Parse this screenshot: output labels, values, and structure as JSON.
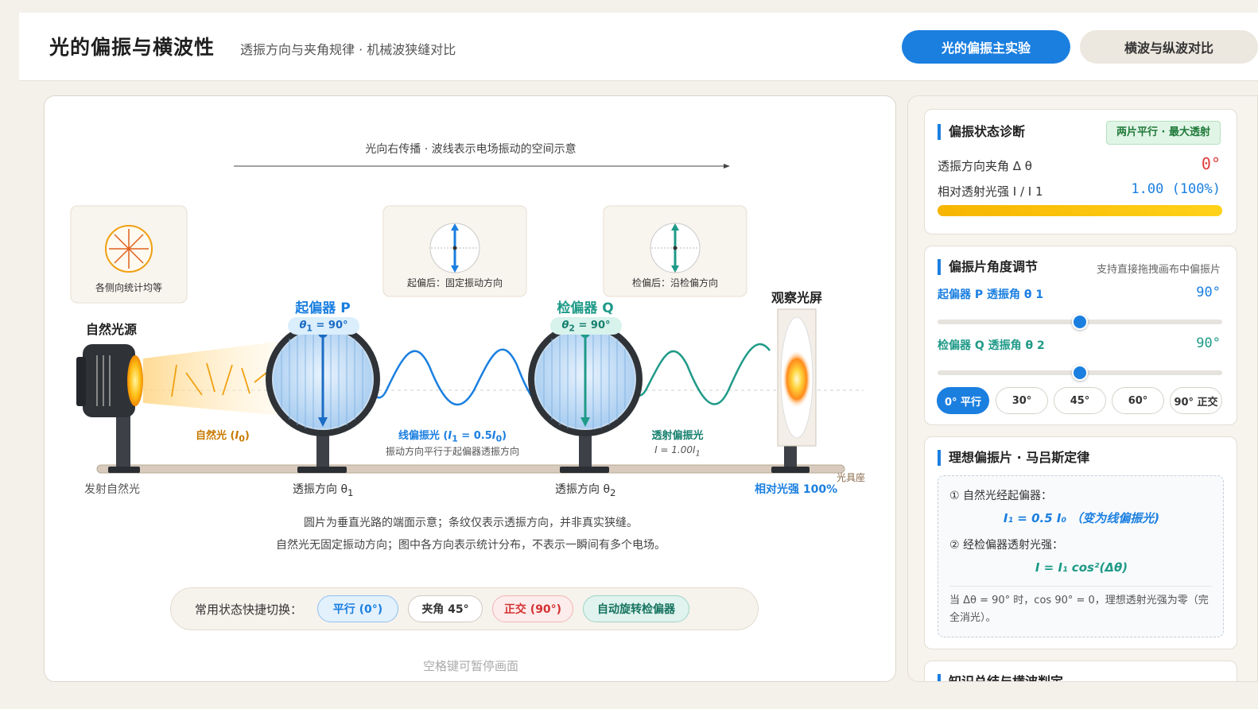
{
  "header": {
    "title": "光的偏振与横波性",
    "subtitle": "透振方向与夹角规律 · 机械波狭缝对比",
    "tabs": [
      {
        "label": "光的偏振主实验",
        "active": true
      },
      {
        "label": "横波与纵波对比",
        "active": false
      }
    ]
  },
  "stage": {
    "propagation_caption": "光向右传播 · 波线表示电场振动的空间示意",
    "source_card_label": "各侧向统计均等",
    "after_polarizer_label": "起偏后：固定振动方向",
    "after_analyzer_label": "检偏后：沿检偏方向",
    "source_title": "自然光源",
    "polarizer_title": "起偏器 P",
    "polarizer_angle": "= 90°",
    "analyzer_title": "检偏器 Q",
    "analyzer_angle": "= 90°",
    "screen_title": "观察光屏",
    "natural_light_label": "自然光 (",
    "natural_light_sym": "I",
    "linear_label": "线偏振光 (",
    "linear_sub": "振动方向平行于起偏器透振方向",
    "transmitted_label": "透射偏振光",
    "transmitted_value": "I = 1.00I",
    "emit_label": "发射自然光",
    "axis_p_label": "透振方向 θ",
    "axis_q_label": "透振方向 θ",
    "bench_label": "光具座",
    "rel_intensity_label": "相对光强 100%",
    "note_line1": "圆片为垂直光路的端面示意；条纹仅表示透振方向，并非真实狭缝。",
    "note_line2": "自然光无固定振动方向；图中各方向表示统计分布，不表示一瞬间有多个电场。",
    "quick_label": "常用状态快捷切换：",
    "quick_buttons": [
      "平行 (0°)",
      "夹角 45°",
      "正交 (90°)",
      "自动旋转检偏器"
    ],
    "pause_hint": "空格键可暂停画面"
  },
  "diagnosis": {
    "title": "偏振状态诊断",
    "badge": "两片平行 · 最大透射",
    "angle_label": "透振方向夹角 Δ θ",
    "angle_value": "0°",
    "intensity_label": "相对透射光强 I / I 1",
    "intensity_value": "1.00 (100%)",
    "intensity_fraction": 1.0
  },
  "adjust": {
    "title": "偏振片角度调节",
    "hint": "支持直接拖拽画布中偏振片",
    "p_label": "起偏器 P 透振角 θ 1",
    "p_value": "90°",
    "p_fraction": 0.5,
    "q_label": "检偏器 Q 透振角 θ 2",
    "q_value": "90°",
    "q_fraction": 0.5,
    "presets": [
      "0° 平行",
      "30°",
      "45°",
      "60°",
      "90° 正交"
    ]
  },
  "malus": {
    "title": "理想偏振片 · 马吕斯定律",
    "step1": "① 自然光经起偏器：",
    "formula1": "I₁ = 0.5 I₀ （变为线偏振光)",
    "step2": "② 经检偏器透射光强：",
    "formula2": "I = I₁ cos²(Δθ)",
    "note": "当 Δθ = 90° 时，cos 90° = 0，理想透射光强为零（完全消光）。"
  },
  "summary": {
    "title": "知识总结与横波判定"
  },
  "colors": {
    "accent": "#1b7fe0",
    "teal": "#1f9a88",
    "natural": "#f0a010",
    "danger": "#e03a3a"
  }
}
